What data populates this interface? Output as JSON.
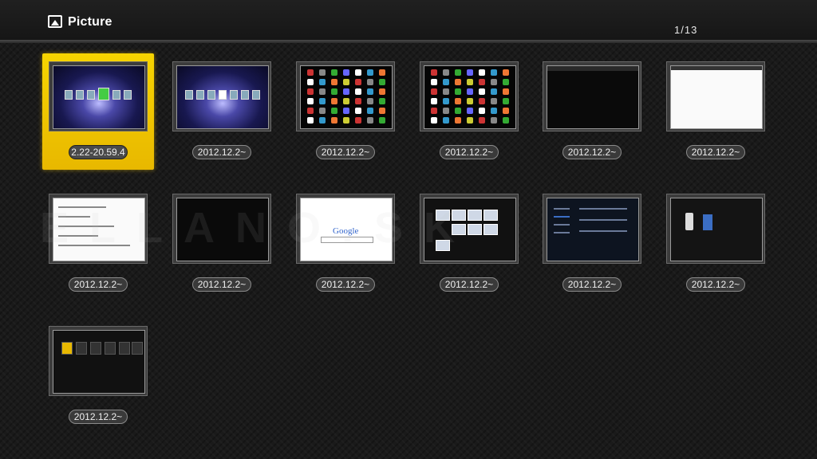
{
  "header": {
    "title": "Picture",
    "page_indicator": "1/13",
    "icon": "picture-icon"
  },
  "thumbnails": [
    {
      "caption": "2.22-20.59.4",
      "selected": true,
      "content": "galaxy-launcher"
    },
    {
      "caption": "2012.12.2~",
      "selected": false,
      "content": "galaxy-launcher"
    },
    {
      "caption": "2012.12.2~",
      "selected": false,
      "content": "app-grid"
    },
    {
      "caption": "2012.12.2~",
      "selected": false,
      "content": "app-grid"
    },
    {
      "caption": "2012.12.2~",
      "selected": false,
      "content": "file-manager-dark"
    },
    {
      "caption": "2012.12.2~",
      "selected": false,
      "content": "file-manager-white"
    },
    {
      "caption": "2012.12.2~",
      "selected": false,
      "content": "document"
    },
    {
      "caption": "2012.12.2~",
      "selected": false,
      "content": "dark-screen"
    },
    {
      "caption": "2012.12.2~",
      "selected": false,
      "content": "google-search"
    },
    {
      "caption": "2012.12.2~",
      "selected": false,
      "content": "gallery"
    },
    {
      "caption": "2012.12.2~",
      "selected": false,
      "content": "settings"
    },
    {
      "caption": "2012.12.2~",
      "selected": false,
      "content": "phone-devices"
    },
    {
      "caption": "2012.12.2~",
      "selected": false,
      "content": "media-tiles"
    }
  ],
  "colors": {
    "selection": "#f2c800",
    "background": "#1a1a1a"
  }
}
